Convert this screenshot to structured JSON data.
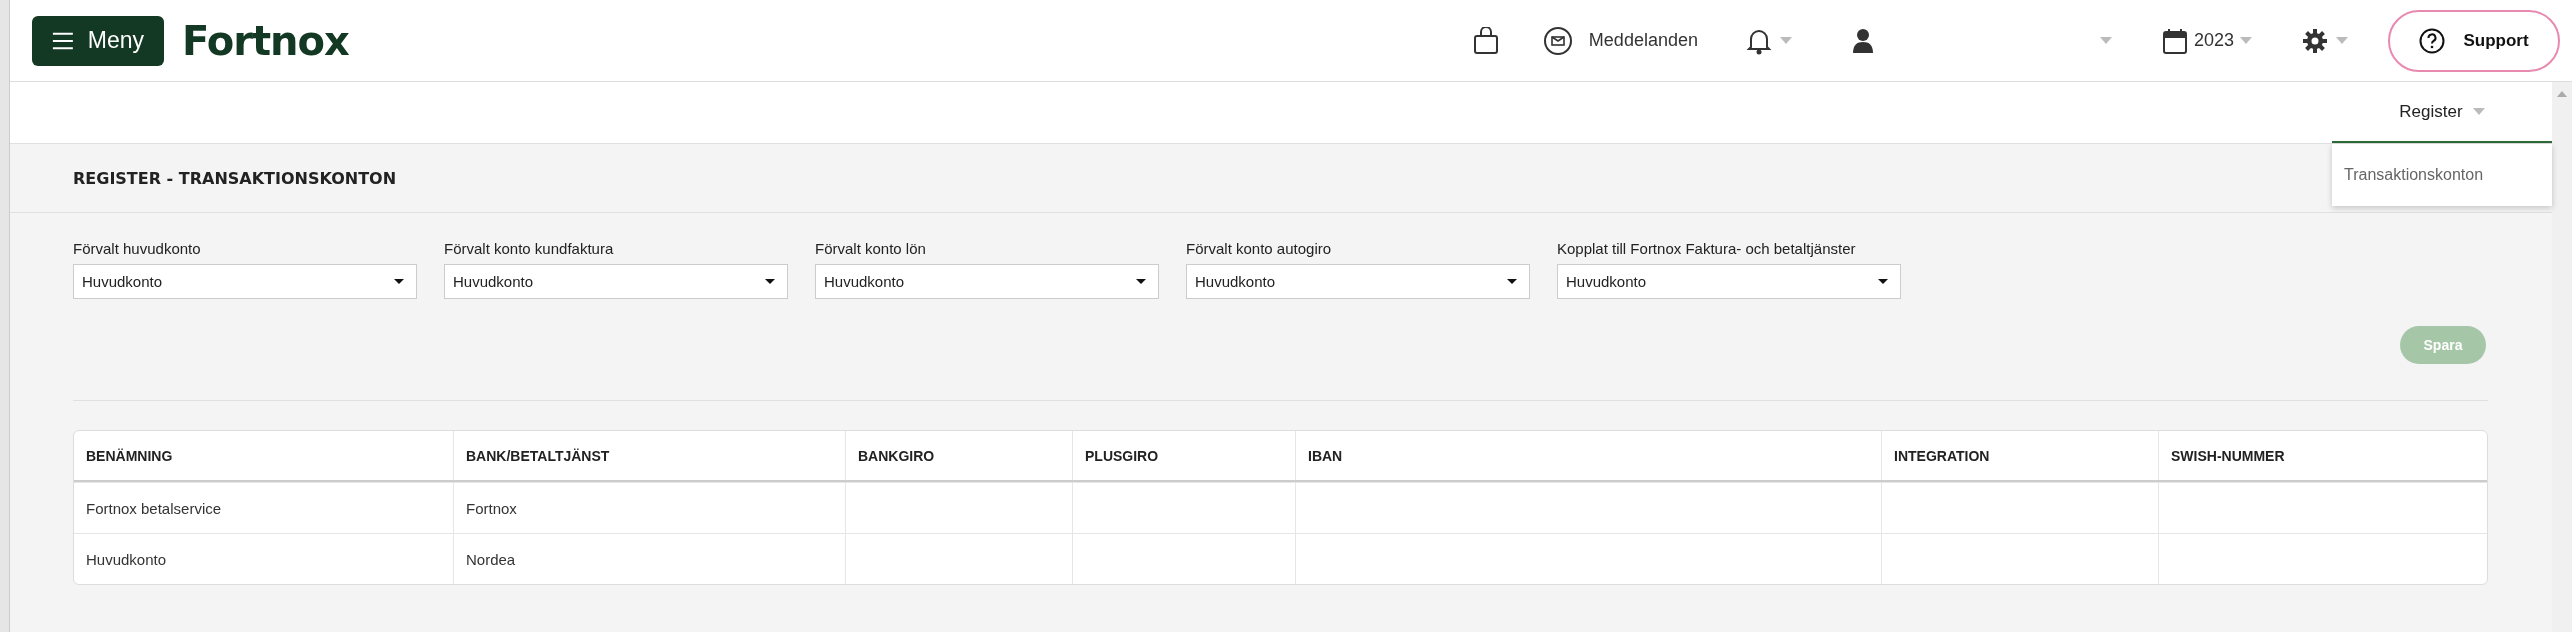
{
  "topbar": {
    "menu_button": "Meny",
    "logo": "Fortnox",
    "messages": "Meddelanden",
    "year": "2023",
    "support": "Support"
  },
  "subnav": {
    "label": "Register",
    "expanded": true,
    "menu_items": [
      "Transaktionskonton"
    ]
  },
  "page": {
    "title": "REGISTER - TRANSAKTIONSKONTON"
  },
  "settings": [
    {
      "label": "Förvalt huvudkonto",
      "value": "Huvudkonto"
    },
    {
      "label": "Förvalt konto kundfaktura",
      "value": "Huvudkonto"
    },
    {
      "label": "Förvalt konto lön",
      "value": "Huvudkonto"
    },
    {
      "label": "Förvalt konto autogiro",
      "value": "Huvudkonto"
    },
    {
      "label": "Kopplat till Fortnox Faktura- och betaltjänster",
      "value": "Huvudkonto"
    }
  ],
  "save_button": {
    "label": "Spara",
    "disabled": true
  },
  "table": {
    "columns": [
      "BENÄMNING",
      "BANK/BETALTJÄNST",
      "BANKGIRO",
      "PLUSGIRO",
      "IBAN",
      "INTEGRATION",
      "SWISH-NUMMER"
    ],
    "rows": [
      [
        "Fortnox betalservice",
        "Fortnox",
        "",
        "",
        "",
        "",
        ""
      ],
      [
        "Huvudkonto",
        "Nordea",
        "",
        "",
        "",
        "",
        ""
      ]
    ]
  }
}
